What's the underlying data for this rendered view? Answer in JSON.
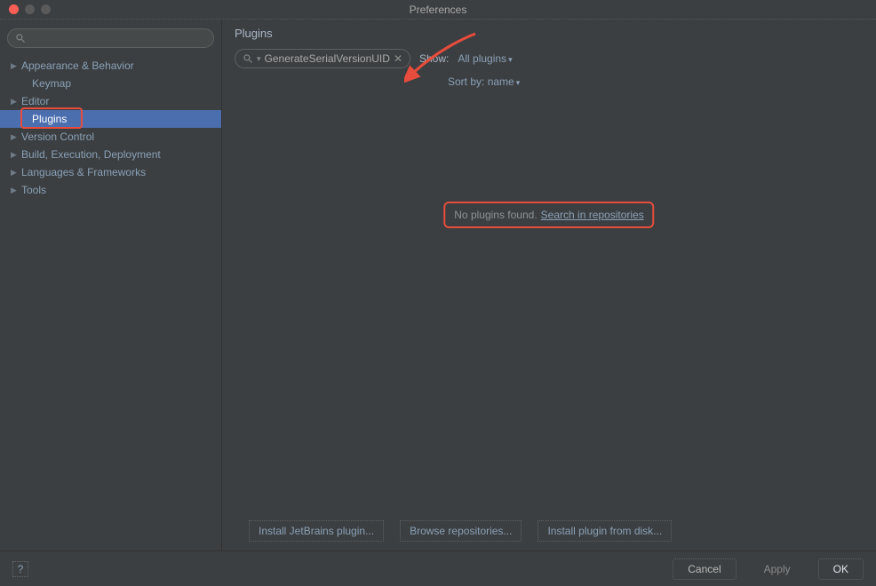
{
  "window": {
    "title": "Preferences"
  },
  "sidebar": {
    "search_placeholder": "",
    "items": [
      {
        "label": "Appearance & Behavior",
        "expandable": true
      },
      {
        "label": "Keymap",
        "expandable": false
      },
      {
        "label": "Editor",
        "expandable": true
      },
      {
        "label": "Plugins",
        "expandable": false,
        "selected": true
      },
      {
        "label": "Version Control",
        "expandable": true
      },
      {
        "label": "Build, Execution, Deployment",
        "expandable": true
      },
      {
        "label": "Languages & Frameworks",
        "expandable": true
      },
      {
        "label": "Tools",
        "expandable": true
      }
    ]
  },
  "main": {
    "section_title": "Plugins",
    "search_value": "GenerateSerialVersionUID",
    "show_label": "Show:",
    "show_value": "All plugins",
    "sort_label": "Sort by:",
    "sort_value": "name",
    "empty_text": "No plugins found.",
    "empty_link": "Search in repositories",
    "actions": {
      "install_jetbrains": "Install JetBrains plugin...",
      "browse_repos": "Browse repositories...",
      "install_disk": "Install plugin from disk..."
    }
  },
  "footer": {
    "help": "?",
    "cancel": "Cancel",
    "apply": "Apply",
    "ok": "OK"
  }
}
